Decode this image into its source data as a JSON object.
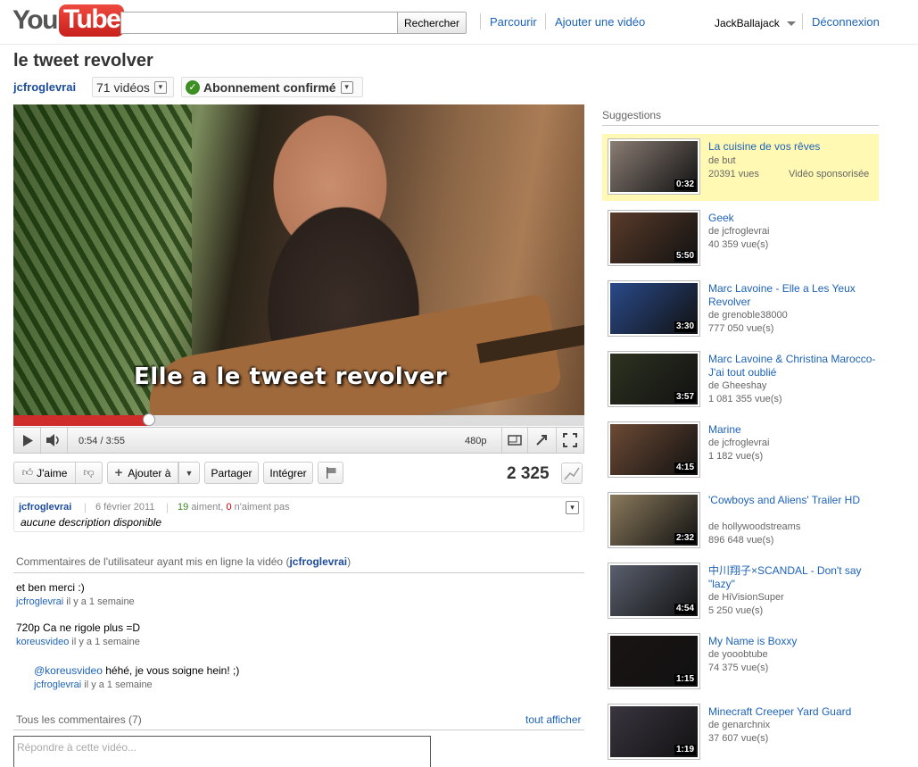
{
  "header": {
    "logo_you": "You",
    "logo_tube": "Tube",
    "search_placeholder": "",
    "search_button": "Rechercher",
    "browse": "Parcourir",
    "upload": "Ajouter une vidéo",
    "username": "JackBallajack",
    "logout": "Déconnexion"
  },
  "video": {
    "title": "le tweet revolver",
    "channel": "jcfroglevrai",
    "video_count": "71 vidéos",
    "subscribe": "Abonnement confirmé",
    "caption": "Elle a le tweet revolver",
    "time": "0:54 / 3:55",
    "quality": "480p",
    "progress": 0.238
  },
  "actions": {
    "like": "J'aime",
    "add_to": "Ajouter à",
    "share": "Partager",
    "embed": "Intégrer",
    "views": "2 325"
  },
  "info": {
    "user": "jcfroglevrai",
    "date": "6 février 2011",
    "likes": "19",
    "likes_label": "aiment,",
    "dislikes": "0",
    "dislikes_label": "n'aiment pas",
    "description": "aucune description disponible"
  },
  "comments": {
    "uploader_heading": "Commentaires de l'utilisateur ayant mis en ligne la vidéo (",
    "uploader_name": "jcfroglevrai",
    "uploader_close": ")",
    "items": [
      {
        "text": "et ben merci :)",
        "user": "jcfroglevrai",
        "ago": "il y a 1 semaine"
      },
      {
        "text": "720p Ca ne rigole plus =D",
        "user": "koreusvideo",
        "ago": "il y a 1 semaine"
      },
      {
        "mention": "@koreusvideo",
        "text": " héhé, je vous soigne hein! ;)",
        "user": "jcfroglevrai",
        "ago": "il y a 1 semaine"
      }
    ],
    "all_heading": "Tous les commentaires (7)",
    "show_all": "tout afficher",
    "reply_placeholder": "Répondre à cette vidéo..."
  },
  "sidebar": {
    "heading": "Suggestions",
    "items": [
      {
        "title": "La cuisine de vos rêves",
        "by": "de but",
        "views": "20391 vues",
        "sponsored": "Vidéo sponsorisée",
        "duration": "0:32",
        "tone": "#8a7d74"
      },
      {
        "title": "Geek",
        "by": "de jcfroglevrai",
        "views": "40 359 vue(s)",
        "duration": "5:50",
        "tone": "#5a3b2a"
      },
      {
        "title": "Marc Lavoine - Elle a Les Yeux Revolver",
        "by": "de grenoble38000",
        "views": "777 050 vue(s)",
        "duration": "3:30",
        "tone": "#2a4a8a"
      },
      {
        "title": "Marc Lavoine & Christina Marocco- J'ai tout oublié",
        "by": "de Gheeshay",
        "views": "1 081 355 vue(s)",
        "duration": "3:57",
        "tone": "#2d3320"
      },
      {
        "title": "Marine",
        "by": "de jcfroglevrai",
        "views": "1 182 vue(s)",
        "duration": "4:15",
        "tone": "#6d4a35"
      },
      {
        "title": "'Cowboys and Aliens' Trailer HD",
        "by": "de hollywoodstreams",
        "views": "896 648 vue(s)",
        "duration": "2:32",
        "tone": "#8a7a5c"
      },
      {
        "title": "中川翔子×SCANDAL - Don't say \"lazy\"",
        "by": "de HiVisionSuper",
        "views": "5 250 vue(s)",
        "duration": "4:54",
        "tone": "#5a5f6d"
      },
      {
        "title": "My Name is Boxxy",
        "by": "de yooobtube",
        "views": "74 375 vue(s)",
        "duration": "1:15",
        "tone": "#1a1414"
      },
      {
        "title": "Minecraft Creeper Yard Guard",
        "by": "de genarchnix",
        "views": "37 607 vue(s)",
        "duration": "1:19",
        "tone": "#3a3540"
      }
    ]
  }
}
